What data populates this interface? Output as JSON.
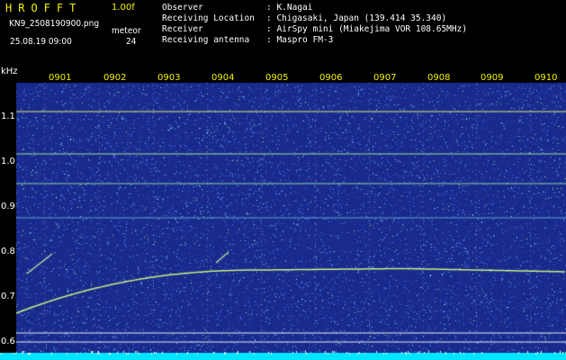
{
  "header": {
    "logo": "HROFFT",
    "version": "1.00f",
    "filename": "KN9_2508190900.png",
    "datetime": "25.08.19 09:00",
    "meteor_label": "meteor",
    "meteor_count": "24"
  },
  "station": {
    "rows": [
      {
        "label": "Observer",
        "value": ": K.Nagai"
      },
      {
        "label": "Receiving Location",
        "value": ": Chigasaki, Japan (139.414 35.340)"
      },
      {
        "label": "Receiver",
        "value": ": AirSpy mini (Miakejima VOR 108.65MHz)"
      },
      {
        "label": "Receiving antenna",
        "value": ": Maspro FM-3"
      }
    ]
  },
  "axes": {
    "y_unit": "kHz",
    "y_ticks": [
      "1.1",
      "1.0",
      "0.9",
      "0.8",
      "0.7",
      "0.6"
    ],
    "x_ticks": [
      "0901",
      "0902",
      "0903",
      "0904",
      "0905",
      "0906",
      "0907",
      "0908",
      "0909",
      "0910"
    ]
  },
  "colors": {
    "background": "#1a2a8c",
    "noise": "#3a6adf",
    "trace": "#c8f080",
    "label_yellow": "#f2f200",
    "baseline": "#00e5ff"
  }
}
